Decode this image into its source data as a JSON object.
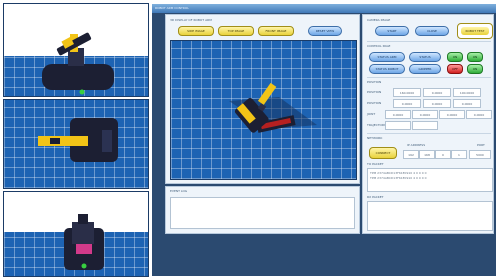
{
  "window": {
    "title": "ROBOT ARM CONTROL"
  },
  "view_panel": {
    "label": "3D DISPLAY OF ROBOT ARM",
    "buttons": {
      "side": "SIDE IMAGE",
      "top": "TOP IMAGE",
      "front": "FRONT IMAGE",
      "reset": "RESET VIEW"
    }
  },
  "camera": {
    "label": "CAMERA IMAGE",
    "start": "START",
    "close": "CLOSE",
    "robot_test": "ROBOT TEST"
  },
  "control": {
    "label": "CONTROL PAGE",
    "move_arm": "STATUS ARM",
    "status": "STATUS",
    "on": "ON",
    "robot_status": "STATUS ROBOT",
    "gripper": "GRIPPER",
    "off": "OFF"
  },
  "position": {
    "label": "POSITION",
    "rows": [
      {
        "label": "POSITION",
        "values": [
          "160.0000",
          "0.0000",
          "100.0000"
        ]
      },
      {
        "label": "POSITION",
        "values": [
          "0.0000",
          "0.0000",
          "0.0000"
        ]
      },
      {
        "label": "JOINT",
        "values": [
          "0.0000",
          "0.0000",
          "0.0000",
          "0.0000"
        ]
      },
      {
        "label": "TRAJECTORY",
        "values": [
          "",
          ""
        ]
      }
    ]
  },
  "network": {
    "label": "NETWORK",
    "connect": "CONNECT",
    "ip_label": "IP ADDRESS",
    "port_label": "PORT",
    "ip_parts": [
      "192",
      "168",
      "0",
      "1"
    ],
    "port": "5000",
    "to_packet_label": "TO PACKET",
    "to_packet_lines": [
      "TPM 2374ABCD13F61E0910 4 0 0 0 0",
      "TPM 2374ABCD13F61E0910 4 0 0 0 0"
    ],
    "rx_packet_label": "RX PACKET"
  },
  "event_log": {
    "label": "EVENT LOG"
  },
  "colors": {
    "grid_floor": "#1d63b3",
    "robot_yellow": "#f2c417",
    "robot_dark": "#1c1f33",
    "app_bg": "#2b4a70"
  },
  "icons": {
    "power_on": "power-on-icon",
    "power_off": "power-off-icon"
  }
}
